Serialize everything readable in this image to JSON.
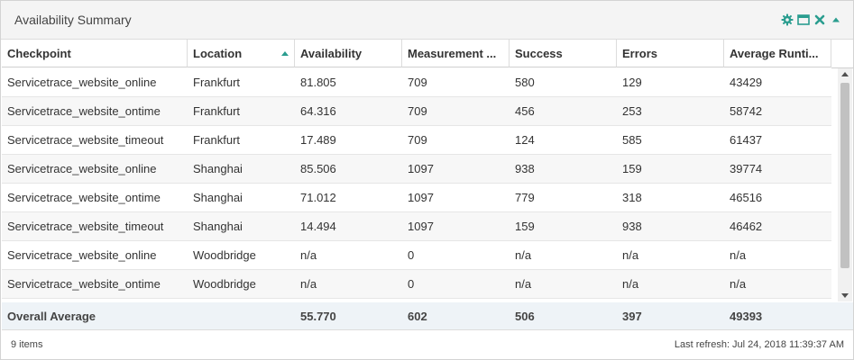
{
  "panel": {
    "title": "Availability Summary",
    "tools": [
      "gear-icon",
      "maximize-icon",
      "close-icon",
      "collapse-icon"
    ],
    "accent_color": "#2a9d8f"
  },
  "grid": {
    "columns": [
      "Checkpoint",
      "Location",
      "Availability",
      "Measurement ...",
      "Success",
      "Errors",
      "Average Runti..."
    ],
    "sorted_column": "Location",
    "sort_direction": "ascending",
    "rows": [
      [
        "Servicetrace_website_online",
        "Frankfurt",
        "81.805",
        "709",
        "580",
        "129",
        "43429"
      ],
      [
        "Servicetrace_website_ontime",
        "Frankfurt",
        "64.316",
        "709",
        "456",
        "253",
        "58742"
      ],
      [
        "Servicetrace_website_timeout",
        "Frankfurt",
        "17.489",
        "709",
        "124",
        "585",
        "61437"
      ],
      [
        "Servicetrace_website_online",
        "Shanghai",
        "85.506",
        "1097",
        "938",
        "159",
        "39774"
      ],
      [
        "Servicetrace_website_ontime",
        "Shanghai",
        "71.012",
        "1097",
        "779",
        "318",
        "46516"
      ],
      [
        "Servicetrace_website_timeout",
        "Shanghai",
        "14.494",
        "1097",
        "159",
        "938",
        "46462"
      ],
      [
        "Servicetrace_website_online",
        "Woodbridge",
        "n/a",
        "0",
        "n/a",
        "n/a",
        "n/a"
      ],
      [
        "Servicetrace_website_ontime",
        "Woodbridge",
        "n/a",
        "0",
        "n/a",
        "n/a",
        "n/a"
      ]
    ],
    "footer": [
      "Overall Average",
      "",
      "55.770",
      "602",
      "506",
      "397",
      "49393"
    ]
  },
  "status": {
    "item_count": "9 items",
    "last_refresh": "Last refresh: Jul 24, 2018 11:39:37 AM"
  }
}
